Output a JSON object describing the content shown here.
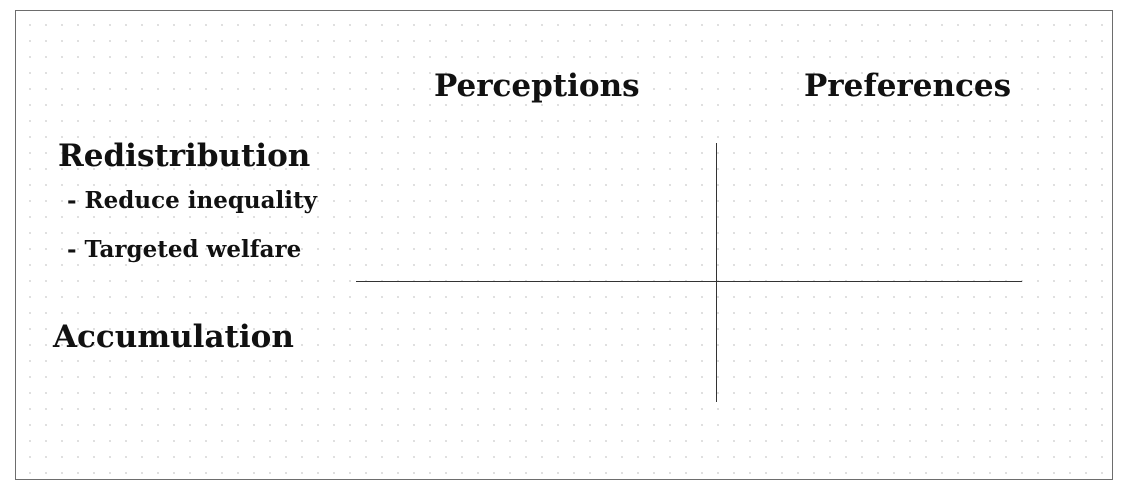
{
  "columns": {
    "perceptions": "Perceptions",
    "preferences": "Preferences"
  },
  "rows": {
    "redistribution": {
      "label": "Redistribution",
      "items": [
        {
          "dash": "-",
          "label": "Reduce inequality"
        },
        {
          "dash": "-",
          "label": "Targeted welfare"
        }
      ]
    },
    "accumulation": {
      "label": "Accumulation"
    }
  }
}
